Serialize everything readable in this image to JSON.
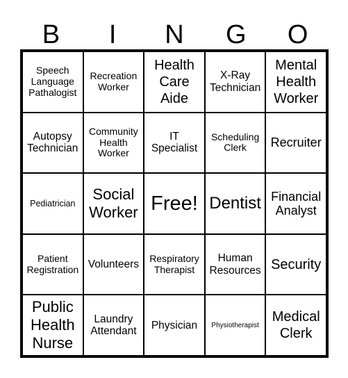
{
  "header": {
    "letters": [
      "B",
      "I",
      "N",
      "G",
      "O"
    ]
  },
  "card": {
    "rows": [
      [
        "Speech Language Pathalogist",
        "Recreation Worker",
        "Health Care Aide",
        "X-Ray Technician",
        "Mental Health Worker"
      ],
      [
        "Autopsy Technician",
        "Community Health Worker",
        "IT Specialist",
        "Scheduling Clerk",
        "Recruiter"
      ],
      [
        "Pediatrician",
        "Social Worker",
        "Free!",
        "Dentist",
        "Financial Analyst"
      ],
      [
        "Patient Registration",
        "Volunteers",
        "Respiratory Therapist",
        "Human Resources",
        "Security"
      ],
      [
        "Public Health Nurse",
        "Laundry Attendant",
        "Physician",
        "Physiotherapist",
        "Medical Clerk"
      ]
    ]
  }
}
